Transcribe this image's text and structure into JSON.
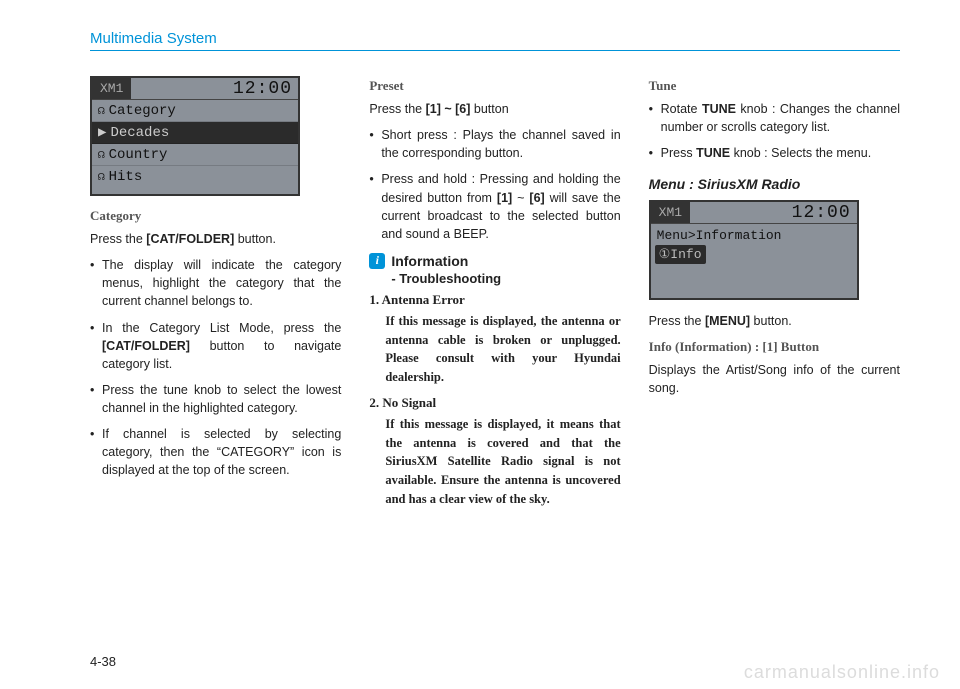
{
  "header": {
    "title": "Multimedia System"
  },
  "radioScreen1": {
    "band": "XM1",
    "time": "12:00",
    "rows": [
      "Category",
      "Decades",
      "Country",
      "Hits"
    ],
    "selectedIndex": 1
  },
  "col1": {
    "subhead": "Category",
    "intro_pre": "Press the ",
    "intro_bold": "[CAT/FOLDER]",
    "intro_post": " button.",
    "bullets": [
      "The display will indicate the category menus, highlight the category that the current channel belongs to.",
      "In the Category List Mode, press the [CAT/FOLDER] button to navigate category list.",
      "Press the tune knob to select the lowest channel in the highlighted category.",
      "If channel is selected by selecting category, then the “CATEGORY” icon is displayed at the top of the screen."
    ],
    "bullet2_bold": "[CAT/FOLDER]"
  },
  "col2": {
    "preset": {
      "subhead": "Preset",
      "intro_pre": "Press the ",
      "intro_bold": "[1] ~ [6]",
      "intro_post": " button",
      "bullets": [
        "Short press : Plays the channel saved in the corresponding button.",
        "Press and hold : Pressing and holding the desired button from [1] ~ [6] will save the current broadcast to the selected button and sound a BEEP."
      ],
      "bullet2_bold1": "[1]",
      "bullet2_bold2": "[6]"
    },
    "info": {
      "label": "Information",
      "sub": "- Troubleshooting",
      "items": [
        {
          "num": "1.",
          "head": "Antenna Error",
          "body": "If this message is displayed, the antenna or antenna cable is broken or unplugged. Please consult with your Hyundai dealership."
        },
        {
          "num": "2.",
          "head": "No Signal",
          "body": "If this message is displayed, it means that the antenna is covered and that the SiriusXM Satellite Radio signal is not available. Ensure the antenna is uncovered and has a clear view of the sky."
        }
      ]
    }
  },
  "col3": {
    "tune": {
      "subhead": "Tune",
      "bullets": [
        {
          "pre": "Rotate ",
          "bold": "TUNE",
          "post": " knob : Changes the channel number or scrolls category list."
        },
        {
          "pre": "Press ",
          "bold": "TUNE",
          "post": " knob : Selects the menu."
        }
      ]
    },
    "menuSection": {
      "title": "Menu : SiriusXM Radio",
      "screen": {
        "band": "XM1",
        "time": "12:00",
        "line1": "Menu>Information",
        "line2": "①Info"
      },
      "press_pre": "Press the ",
      "press_bold": "[MENU]",
      "press_post": " button.",
      "infoSubhead": "Info (Information) : [1] Button",
      "infoBody": "Displays the Artist/Song info of the current song."
    }
  },
  "pageNumber": "4-38",
  "watermark": "carmanualsonline.info"
}
